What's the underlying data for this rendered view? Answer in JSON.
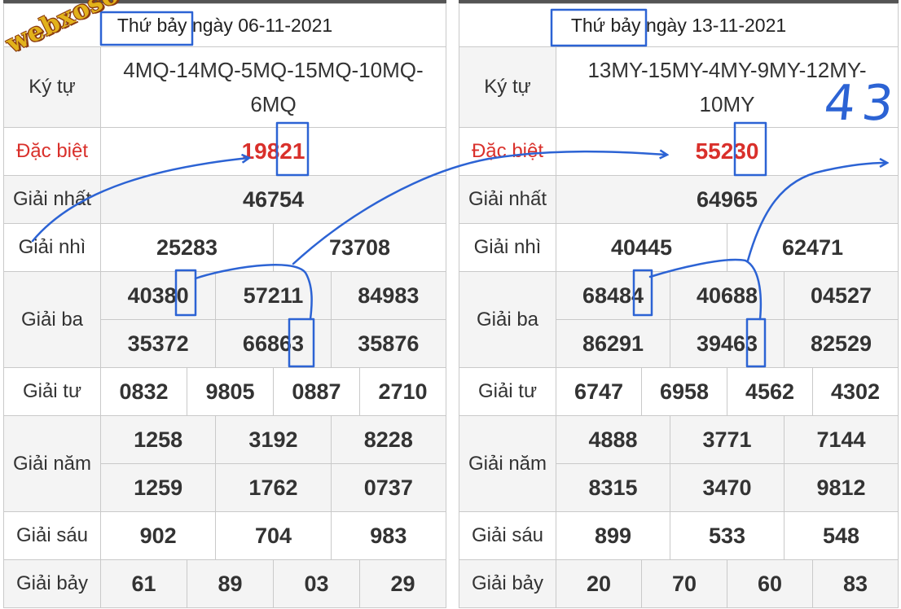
{
  "left": {
    "date": "Thứ bảy ngày 06-11-2021",
    "ky_tu_label": "Ký tự",
    "ky_tu": "4MQ-14MQ-5MQ-15MQ-10MQ-6MQ",
    "dac_biet_label": "Đặc biệt",
    "dac_biet": "19821",
    "nhat_label": "Giải nhất",
    "nhat": "46754",
    "nhi_label": "Giải nhì",
    "nhi": [
      "25283",
      "73708"
    ],
    "ba_label": "Giải ba",
    "ba": [
      "40380",
      "57211",
      "84983",
      "35372",
      "66863",
      "35876"
    ],
    "tu_label": "Giải tư",
    "tu": [
      "0832",
      "9805",
      "0887",
      "2710"
    ],
    "nam_label": "Giải năm",
    "nam": [
      "1258",
      "3192",
      "8228",
      "1259",
      "1762",
      "0737"
    ],
    "sau_label": "Giải sáu",
    "sau": [
      "902",
      "704",
      "983"
    ],
    "bay_label": "Giải bảy",
    "bay": [
      "61",
      "89",
      "03",
      "29"
    ]
  },
  "right": {
    "date": "Thứ bảy ngày 13-11-2021",
    "ky_tu_label": "Ký tự",
    "ky_tu": "13MY-15MY-4MY-9MY-12MY-10MY",
    "dac_biet_label": "Đặc biệt",
    "dac_biet": "55230",
    "nhat_label": "Giải nhất",
    "nhat": "64965",
    "nhi_label": "Giải nhì",
    "nhi": [
      "40445",
      "62471"
    ],
    "ba_label": "Giải ba",
    "ba": [
      "68484",
      "40688",
      "04527",
      "86291",
      "39463",
      "82529"
    ],
    "tu_label": "Giải tư",
    "tu": [
      "6747",
      "6958",
      "4562",
      "4302"
    ],
    "nam_label": "Giải năm",
    "nam": [
      "4888",
      "3771",
      "7144",
      "8315",
      "3470",
      "9812"
    ],
    "sau_label": "Giải sáu",
    "sau": [
      "899",
      "533",
      "548"
    ],
    "bay_label": "Giải bảy",
    "bay": [
      "20",
      "70",
      "60",
      "83"
    ]
  },
  "watermark": "webxoso.net",
  "handwritten_note": "43",
  "colors": {
    "special_red": "#d9302b",
    "annotation_blue": "#2c63d4",
    "watermark_gold": "#e2b21b",
    "zebra": "#f4f4f4",
    "border": "#c9c9c9"
  }
}
